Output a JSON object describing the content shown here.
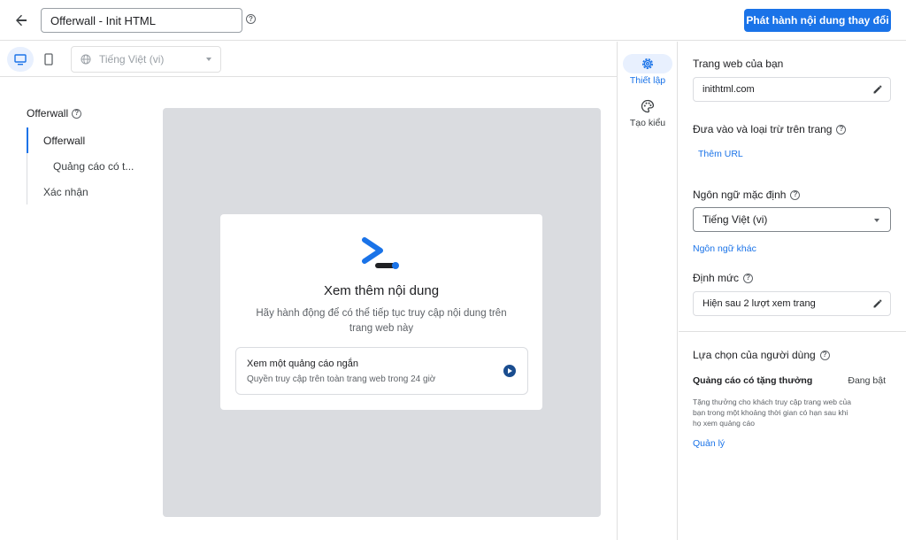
{
  "header": {
    "title_value": "Offerwall - Init HTML",
    "publish_label": "Phát hành nội dung thay đổi"
  },
  "preview": {
    "language_placeholder": "Tiếng Việt (vi)"
  },
  "nav": {
    "title": "Offerwall",
    "items": [
      {
        "label": "Offerwall"
      },
      {
        "label": "Quảng cáo có t..."
      },
      {
        "label": "Xác nhận"
      }
    ]
  },
  "card": {
    "title": "Xem thêm nội dung",
    "description": "Hãy hành động để có thể tiếp tục truy cập nội dung trên trang web này",
    "option_title": "Xem một quảng cáo ngắn",
    "option_subtitle": "Quyền truy cập trên toàn trang web trong 24 giờ"
  },
  "rail": {
    "settings_label": "Thiết lập",
    "style_label": "Tạo kiểu"
  },
  "settings": {
    "site_label": "Trang web của bạn",
    "site_value": "inithtml.com",
    "include_label": "Đưa vào và loại trừ trên trang",
    "add_url": "Thêm URL",
    "default_lang_label": "Ngôn ngữ mặc định",
    "default_lang_value": "Tiếng Việt (vi)",
    "other_lang": "Ngôn ngữ khác",
    "frequency_label": "Định mức",
    "frequency_value": "Hiện sau 2 lượt xem trang",
    "user_choice_label": "Lựa chọn của người dùng",
    "choice_title": "Quảng cáo có tặng thưởng",
    "choice_status": "Đang bật",
    "choice_desc": "Tặng thưởng cho khách truy cập trang web của bạn trong một khoảng thời gian có hạn sau khi họ xem quảng cáo",
    "manage": "Quản lý"
  },
  "colors": {
    "accent": "#1a73e8",
    "stage": "#dadce0"
  }
}
